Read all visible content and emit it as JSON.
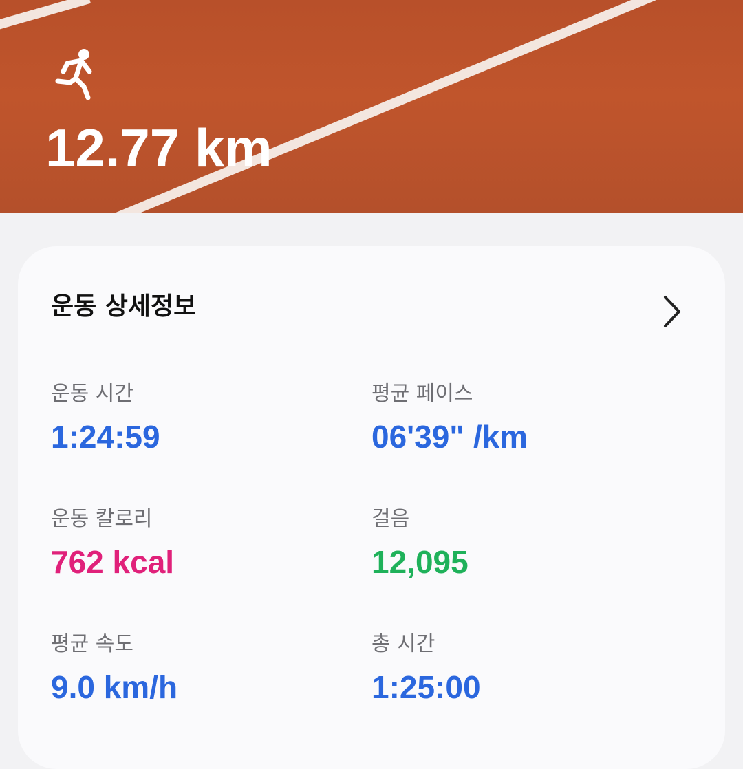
{
  "header": {
    "activity_icon": "running-person-icon",
    "distance": "12.77 km"
  },
  "details": {
    "title": "운동 상세정보",
    "chevron_icon": "chevron-right-icon",
    "stats": [
      {
        "label": "운동 시간",
        "value": "1:24:59",
        "color": "#2b67de"
      },
      {
        "label": "평균 페이스",
        "value": "06'39\" /km",
        "color": "#2b67de"
      },
      {
        "label": "운동 칼로리",
        "value": "762 kcal",
        "color": "#e0217a"
      },
      {
        "label": "걸음",
        "value": "12,095",
        "color": "#1fb15a"
      },
      {
        "label": "평균 속도",
        "value": "9.0 km/h",
        "color": "#2b67de"
      },
      {
        "label": "총 시간",
        "value": "1:25:00",
        "color": "#2b67de"
      }
    ]
  }
}
